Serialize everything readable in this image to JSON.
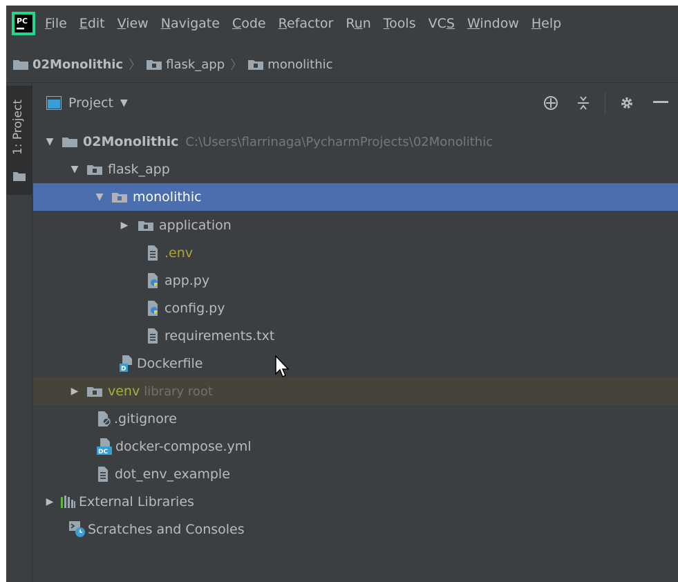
{
  "menu": {
    "items": [
      {
        "pre": "",
        "mn": "F",
        "post": "ile"
      },
      {
        "pre": "",
        "mn": "E",
        "post": "dit"
      },
      {
        "pre": "",
        "mn": "V",
        "post": "iew"
      },
      {
        "pre": "",
        "mn": "N",
        "post": "avigate"
      },
      {
        "pre": "",
        "mn": "C",
        "post": "ode"
      },
      {
        "pre": "",
        "mn": "R",
        "post": "efactor"
      },
      {
        "pre": "R",
        "mn": "u",
        "post": "n"
      },
      {
        "pre": "",
        "mn": "T",
        "post": "ools"
      },
      {
        "pre": "VC",
        "mn": "S",
        "post": ""
      },
      {
        "pre": "",
        "mn": "W",
        "post": "indow"
      },
      {
        "pre": "",
        "mn": "H",
        "post": "elp"
      }
    ],
    "logo_text": "PC"
  },
  "breadcrumb": {
    "items": [
      "02Monolithic",
      "flask_app",
      "monolithic"
    ]
  },
  "toolstrip": {
    "project_label": "1: Project"
  },
  "panel": {
    "title": "Project",
    "dropdown_glyph": "▼"
  },
  "tree": {
    "root_name": "02Monolithic",
    "root_path": "C:\\Users\\flarrinaga\\PycharmProjects\\02Monolithic",
    "flask_app": "flask_app",
    "monolithic": "monolithic",
    "application": "application",
    "env": ".env",
    "app_py": "app.py",
    "config_py": "config.py",
    "requirements": "requirements.txt",
    "dockerfile": "Dockerfile",
    "venv": "venv",
    "venv_extra": "library root",
    "gitignore": ".gitignore",
    "docker_compose": "docker-compose.yml",
    "dot_env_example": "dot_env_example",
    "external_libraries": "External Libraries",
    "scratches": "Scratches and Consoles"
  },
  "icons": {
    "expanded": "▼",
    "collapsed": "▶"
  },
  "colors": {
    "background": "#3c3f41",
    "selection": "#4b6eaf",
    "library_row": "#45433a",
    "text": "#bbbbbb",
    "muted_text": "#75787a",
    "env_file": "#b0a235",
    "venv_folder": "#a6b041"
  }
}
